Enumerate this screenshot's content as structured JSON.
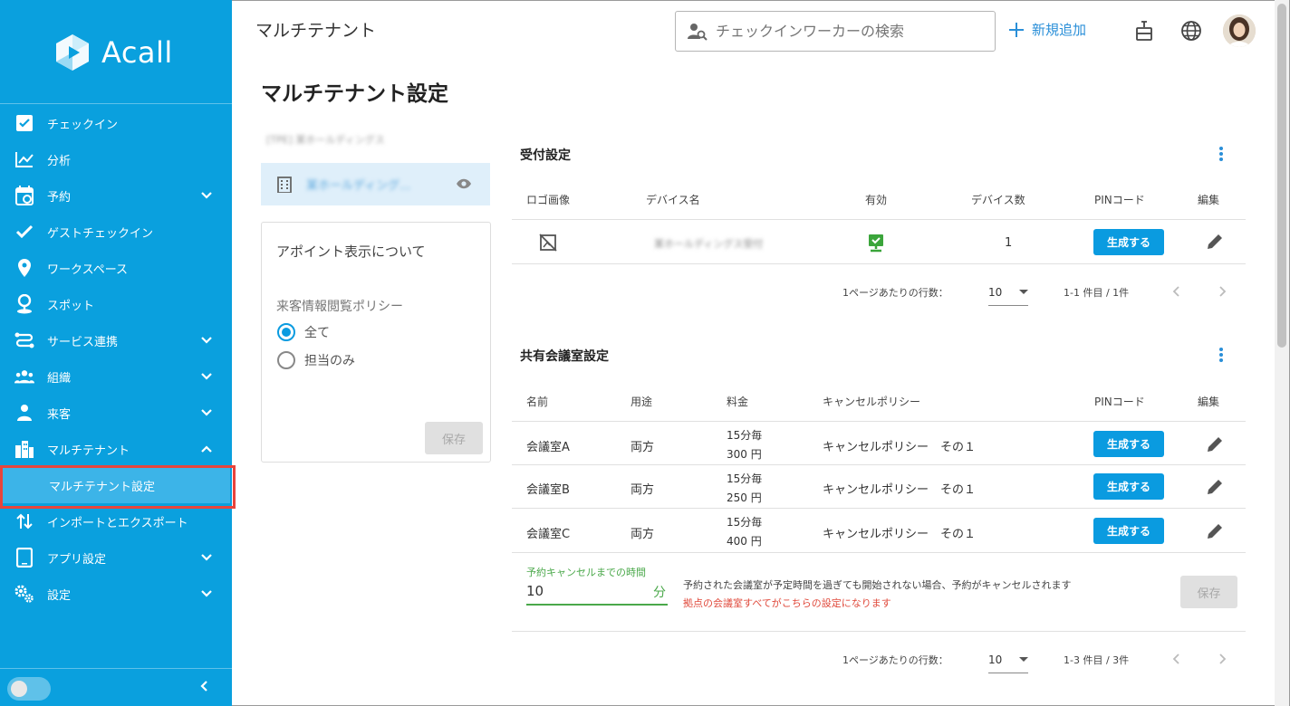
{
  "brand": {
    "name": "Acall",
    "accent": "#0aa0de"
  },
  "sidebar": {
    "items": [
      {
        "label": "チェックイン",
        "icon": "checkbox-icon"
      },
      {
        "label": "分析",
        "icon": "chart-icon"
      },
      {
        "label": "予約",
        "icon": "calendar-icon",
        "expandable": true
      },
      {
        "label": "ゲストチェックイン",
        "icon": "check-icon"
      },
      {
        "label": "ワークスペース",
        "icon": "location-pin-icon"
      },
      {
        "label": "スポット",
        "icon": "person-pin-icon"
      },
      {
        "label": "サービス連携",
        "icon": "integration-icon",
        "expandable": true
      },
      {
        "label": "組織",
        "icon": "group-icon",
        "expandable": true
      },
      {
        "label": "来客",
        "icon": "visitor-icon",
        "expandable": true
      },
      {
        "label": "マルチテナント",
        "icon": "building-icon",
        "expanded": true
      },
      {
        "label": "インポートとエクスポート",
        "icon": "import-export-icon"
      },
      {
        "label": "アプリ設定",
        "icon": "tablet-icon",
        "expandable": true
      },
      {
        "label": "設定",
        "icon": "settings-icon",
        "expandable": true
      }
    ],
    "sub_item": "マルチテナント設定"
  },
  "header": {
    "title": "マルチテナント",
    "search_placeholder": "チェックインワーカーの検索",
    "add_new": "新規追加"
  },
  "page": {
    "title": "マルチテナント設定"
  },
  "left_panel": {
    "tenant_label": "[TPE] 某ホールディングス",
    "tenant_name": "某ホールディング..."
  },
  "appoint_card": {
    "title": "アポイント表示について",
    "policy_label": "来客情報閲覧ポリシー",
    "option_all": "全て",
    "option_assignee": "担当のみ",
    "save": "保存",
    "selected": "全て"
  },
  "reception": {
    "title": "受付設定",
    "headers": [
      "ロゴ画像",
      "デバイス名",
      "有効",
      "デバイス数",
      "PINコード",
      "編集"
    ],
    "row": {
      "device_name": "某ホールディングス受付",
      "count": "1",
      "pin_button": "生成する"
    },
    "pager": {
      "rows_label": "1ページあたりの行数：",
      "rows": "10",
      "range": "1-1 件目 / 1件"
    }
  },
  "meeting": {
    "title": "共有会議室設定",
    "headers": [
      "名前",
      "用途",
      "料金",
      "キャンセルポリシー",
      "PINコード",
      "編集"
    ],
    "rows": [
      {
        "name": "会議室A",
        "use": "両方",
        "fee1": "15分毎",
        "fee2": "300 円",
        "policy": "キャンセルポリシー　その１",
        "pin_button": "生成する"
      },
      {
        "name": "会議室B",
        "use": "両方",
        "fee1": "15分毎",
        "fee2": "250 円",
        "policy": "キャンセルポリシー　その１",
        "pin_button": "生成する"
      },
      {
        "name": "会議室C",
        "use": "両方",
        "fee1": "15分毎",
        "fee2": "400 円",
        "policy": "キャンセルポリシー　その１",
        "pin_button": "生成する"
      }
    ],
    "cancel_label": "予約キャンセルまでの時間",
    "cancel_value": "10",
    "cancel_unit": "分",
    "note1": "予約された会議室が予定時間を過ぎても開始されない場合、予約がキャンセルされます",
    "note2": "拠点の会議室すべてがこちらの設定になります",
    "save": "保存",
    "pager": {
      "rows_label": "1ページあたりの行数：",
      "rows": "10",
      "range": "1-3 件目 / 3件"
    }
  }
}
